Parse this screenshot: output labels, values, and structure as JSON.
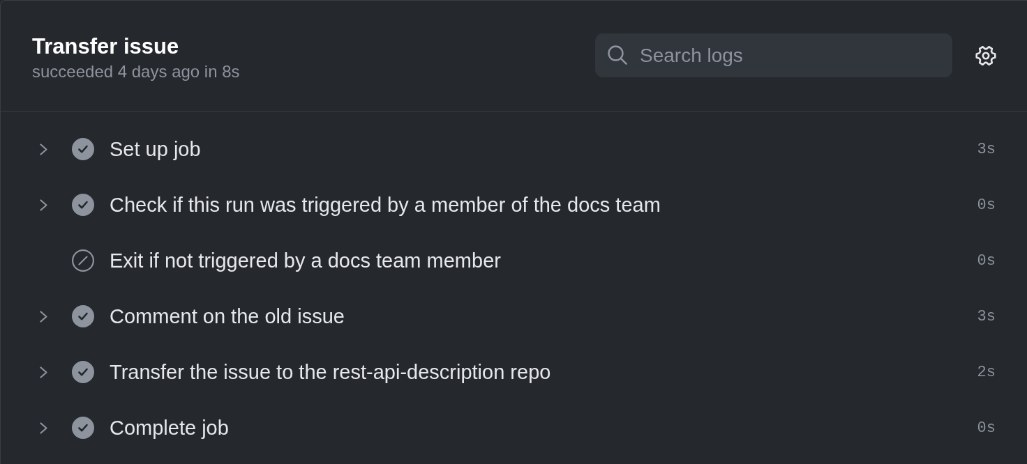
{
  "job": {
    "title": "Transfer issue",
    "subtitle": "succeeded 4 days ago in 8s"
  },
  "search": {
    "placeholder": "Search logs"
  },
  "steps": [
    {
      "name": "Set up job",
      "kind": "success",
      "expandable": true,
      "duration": "3s"
    },
    {
      "name": "Check if this run was triggered by a member of the docs team",
      "kind": "success",
      "expandable": true,
      "duration": "0s"
    },
    {
      "name": "Exit if not triggered by a docs team member",
      "kind": "skipped",
      "expandable": false,
      "duration": "0s"
    },
    {
      "name": "Comment on the old issue",
      "kind": "success",
      "expandable": true,
      "duration": "3s"
    },
    {
      "name": "Transfer the issue to the rest-api-description repo",
      "kind": "success",
      "expandable": true,
      "duration": "2s"
    },
    {
      "name": "Complete job",
      "kind": "success",
      "expandable": true,
      "duration": "0s"
    }
  ]
}
